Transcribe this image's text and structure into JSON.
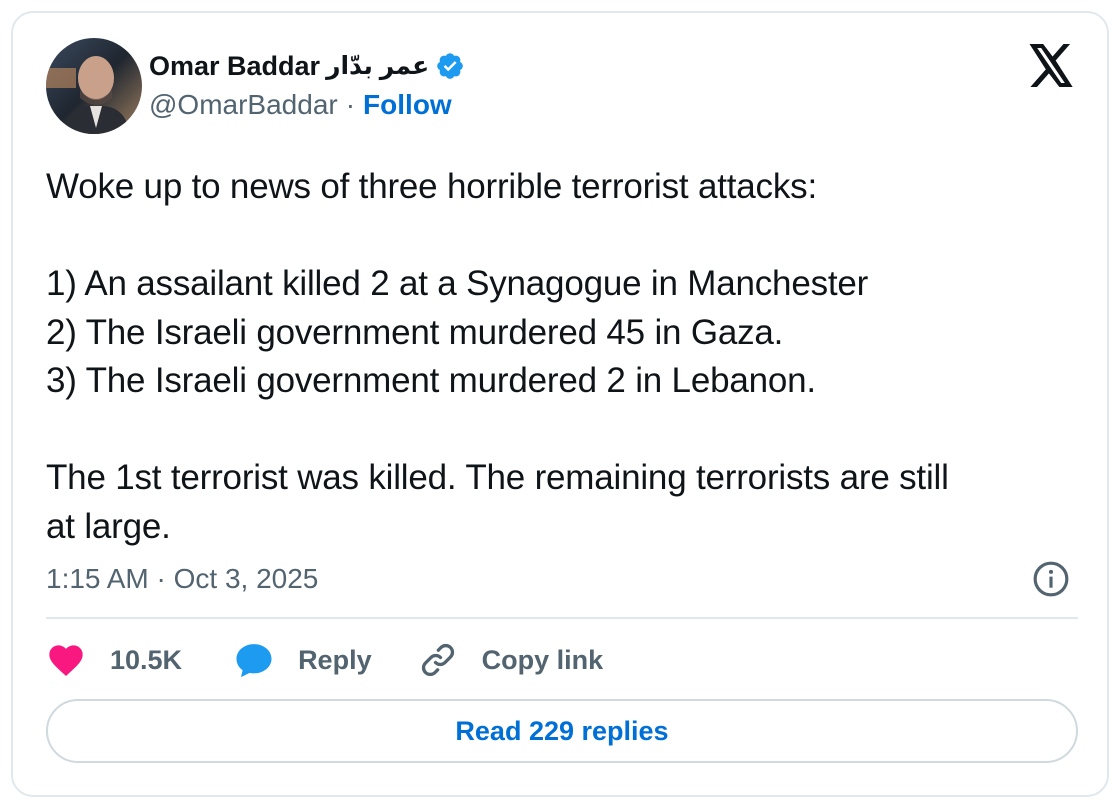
{
  "author": {
    "display_name": "Omar Baddar",
    "arabic_name": "عمر بدّار",
    "handle": "@OmarBaddar",
    "separator": "·",
    "follow_label": "Follow",
    "verified": true
  },
  "tweet": {
    "lines": [
      "Woke up to news of three horrible terrorist attacks:",
      "",
      "1) An assailant killed 2 at a Synagogue in Manchester",
      "2) The Israeli government murdered 45 in Gaza.",
      "3) The Israeli government murdered 2 in Lebanon.",
      "",
      "The 1st terrorist was killed. The remaining terrorists are still",
      "at large."
    ],
    "timestamp": "1:15 AM · Oct 3, 2025"
  },
  "actions": {
    "like_count": "10.5K",
    "reply_label": "Reply",
    "copy_link_label": "Copy link"
  },
  "read_replies_label": "Read 229 replies",
  "colors": {
    "link_blue": "#006fd6",
    "verified_blue": "#1d9bf0",
    "like_pink": "#f91880",
    "muted_gray": "#536471",
    "text": "#0f1419",
    "border": "#e1e8ed"
  },
  "icons": [
    "avatar",
    "verified-badge-icon",
    "x-logo-icon",
    "info-icon",
    "heart-icon",
    "reply-bubble-icon",
    "link-icon"
  ]
}
